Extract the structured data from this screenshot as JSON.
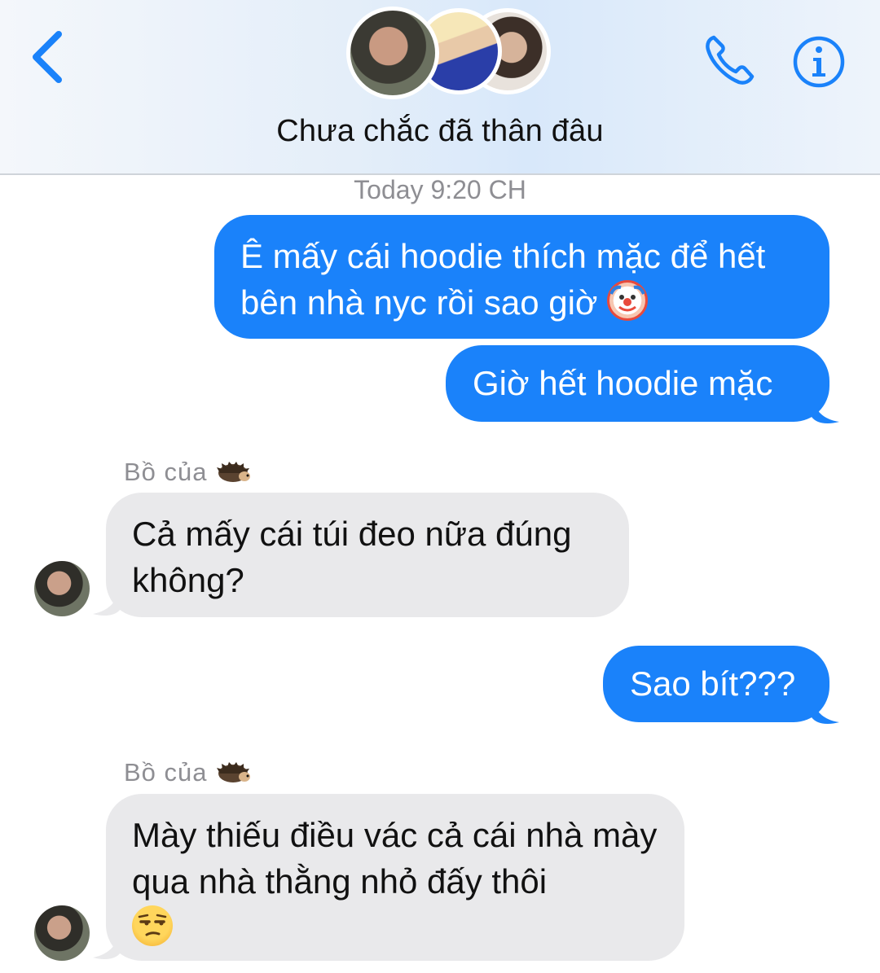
{
  "header": {
    "title": "Chưa chắc đã thân đâu",
    "accent_color": "#1a82fa",
    "back_icon": "chevron-left-icon",
    "call_icon": "phone-icon",
    "info_icon": "info-icon"
  },
  "conversation": {
    "timestamp": "Today 9:20 CH",
    "messages": [
      {
        "direction": "outgoing",
        "text": "Ê mấy cái hoodie thích mặc để hết bên nhà nyc rồi sao giờ",
        "emoji": "clown-face"
      },
      {
        "direction": "outgoing",
        "text": "Giờ hết hoodie mặc"
      },
      {
        "direction": "incoming",
        "sender": "Bồ của",
        "sender_emoji": "hedgehog",
        "text": "Cả mấy cái túi đeo nữa đúng không?"
      },
      {
        "direction": "outgoing",
        "text": "Sao bít???"
      },
      {
        "direction": "incoming",
        "sender": "Bồ của",
        "sender_emoji": "hedgehog",
        "text": "Mày thiếu điều vác cả cái nhà mày qua nhà thằng nhỏ đấy thôi",
        "emoji": "unamused-face"
      }
    ]
  }
}
